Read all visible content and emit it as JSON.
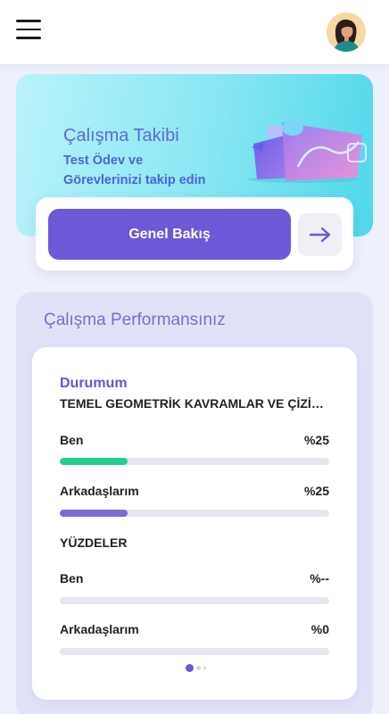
{
  "header": {
    "menu_icon": "hamburger-menu-icon",
    "avatar_icon": "user-avatar"
  },
  "hero": {
    "title": "Çalışma Takibi",
    "subtitle": "Test Ödev ve Görevlerinizi takip edin",
    "illustration": "study-tracking-illustration",
    "button_label": "Genel Bakış",
    "arrow_icon": "arrow-right-icon"
  },
  "performance": {
    "title": "Çalışma Performansınız",
    "status_label": "Durumum",
    "topic": "TEMEL GEOMETRİK KAVRAMLAR VE ÇİZİMLER",
    "status_rows": [
      {
        "label": "Ben",
        "value": "%25",
        "progress": 0.25,
        "color": "#22cf8e"
      },
      {
        "label": "Arkadaşlarım",
        "value": "%25",
        "progress": 0.25,
        "color": "#7c6ad8"
      }
    ],
    "percent_section_label": "YÜZDELER",
    "percent_rows": [
      {
        "label": "Ben",
        "value": "%--",
        "progress": 0
      },
      {
        "label": "Arkadaşlarım",
        "value": "%0",
        "progress": 0
      }
    ],
    "pager": {
      "pages": 3,
      "active": 0
    }
  },
  "colors": {
    "accent": "#6d59d8",
    "green": "#22cf8e",
    "purple_bar": "#7c6ad8"
  }
}
